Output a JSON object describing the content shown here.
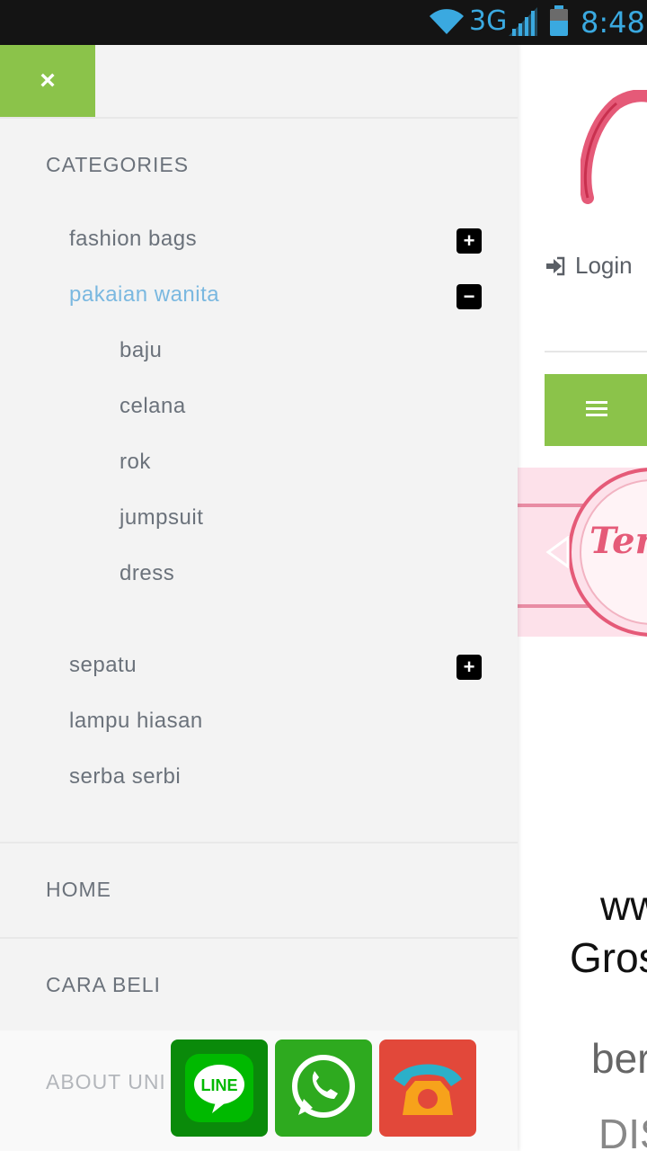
{
  "status_bar": {
    "network": "3G",
    "time": "8:48"
  },
  "drawer": {
    "close_icon": "×",
    "categories_title": "CATEGORIES",
    "categories": [
      {
        "label": "fashion bags",
        "toggle": "+"
      },
      {
        "label": "pakaian wanita",
        "toggle": "−",
        "active": true
      },
      {
        "label": "sepatu",
        "toggle": "+"
      },
      {
        "label": "lampu hiasan"
      },
      {
        "label": "serba serbi"
      }
    ],
    "subcategories": [
      "baju",
      "celana",
      "rok",
      "jumpsuit",
      "dress"
    ],
    "nav": {
      "home": "HOME",
      "cara_beli": "CARA BELI",
      "about": "ABOUT UNI"
    }
  },
  "site": {
    "login_label": "Login",
    "banner_text": "Ter",
    "text_line1": "ww",
    "text_line2": "Gros",
    "text_line3": "ber",
    "text_line4": "DIS"
  },
  "chat_buttons": {
    "line_label": "LINE"
  },
  "colors": {
    "accent_green": "#8bc34a",
    "active_blue": "#7ab8e0",
    "status_blue": "#3aa9e0"
  }
}
